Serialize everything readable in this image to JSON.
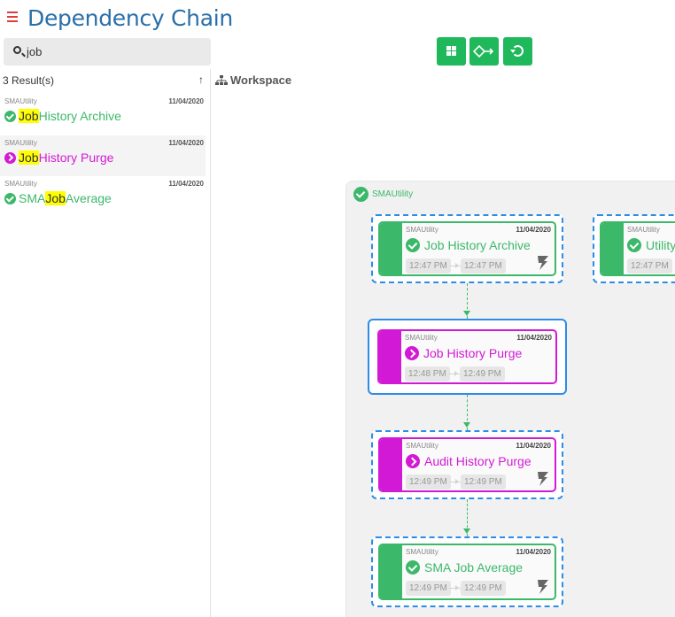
{
  "header": {
    "title": "Dependency Chain",
    "menu_icon": "hamburger-icon"
  },
  "search": {
    "value": "job",
    "placeholder": ""
  },
  "results": {
    "count_label": "3 Result(s)",
    "sort_icon": "↑",
    "items": [
      {
        "group": "SMAUtility",
        "date": "11/04/2020",
        "pre": "",
        "match": "Job",
        "post": " History Archive",
        "status": "success",
        "color": "#3cb86a"
      },
      {
        "group": "SMAUtility",
        "date": "11/04/2020",
        "pre": "",
        "match": "Job",
        "post": " History Purge",
        "status": "running",
        "color": "#d21ad6"
      },
      {
        "group": "SMAUtility",
        "date": "11/04/2020",
        "pre": "SMA ",
        "match": "Job",
        "post": " Average",
        "status": "success",
        "color": "#3cb86a"
      }
    ]
  },
  "toolbar": {
    "buttons": [
      "grid-icon",
      "diamond-arrow-icon",
      "refresh-icon"
    ]
  },
  "workspace": {
    "label": "Workspace",
    "group_name": "SMAUtility",
    "nodes": [
      {
        "group": "SMAUtility",
        "date": "11/04/2020",
        "name": "Job History Archive",
        "status": "success",
        "start": "12:47 PM",
        "end": "12:47 PM"
      },
      {
        "group": "SMAUtility",
        "date": "11/04/2020",
        "name": "Job History Purge",
        "status": "running",
        "start": "12:48 PM",
        "end": "12:49 PM"
      },
      {
        "group": "SMAUtility",
        "date": "11/04/2020",
        "name": "Audit History Purge",
        "status": "running",
        "start": "12:49 PM",
        "end": "12:49 PM"
      },
      {
        "group": "SMAUtility",
        "date": "11/04/2020",
        "name": "SMA Job Average",
        "status": "success",
        "start": "12:49 PM",
        "end": "12:49 PM"
      },
      {
        "group": "SMAUtility",
        "date": "",
        "name": "Utility",
        "status": "success",
        "start": "12:47 PM",
        "end": ""
      }
    ]
  },
  "colors": {
    "success": "#3cb86a",
    "running": "#d21ad6",
    "accent": "#2a6fa8",
    "toolbar": "#1fb85a",
    "selection": "#2c8ce6"
  }
}
